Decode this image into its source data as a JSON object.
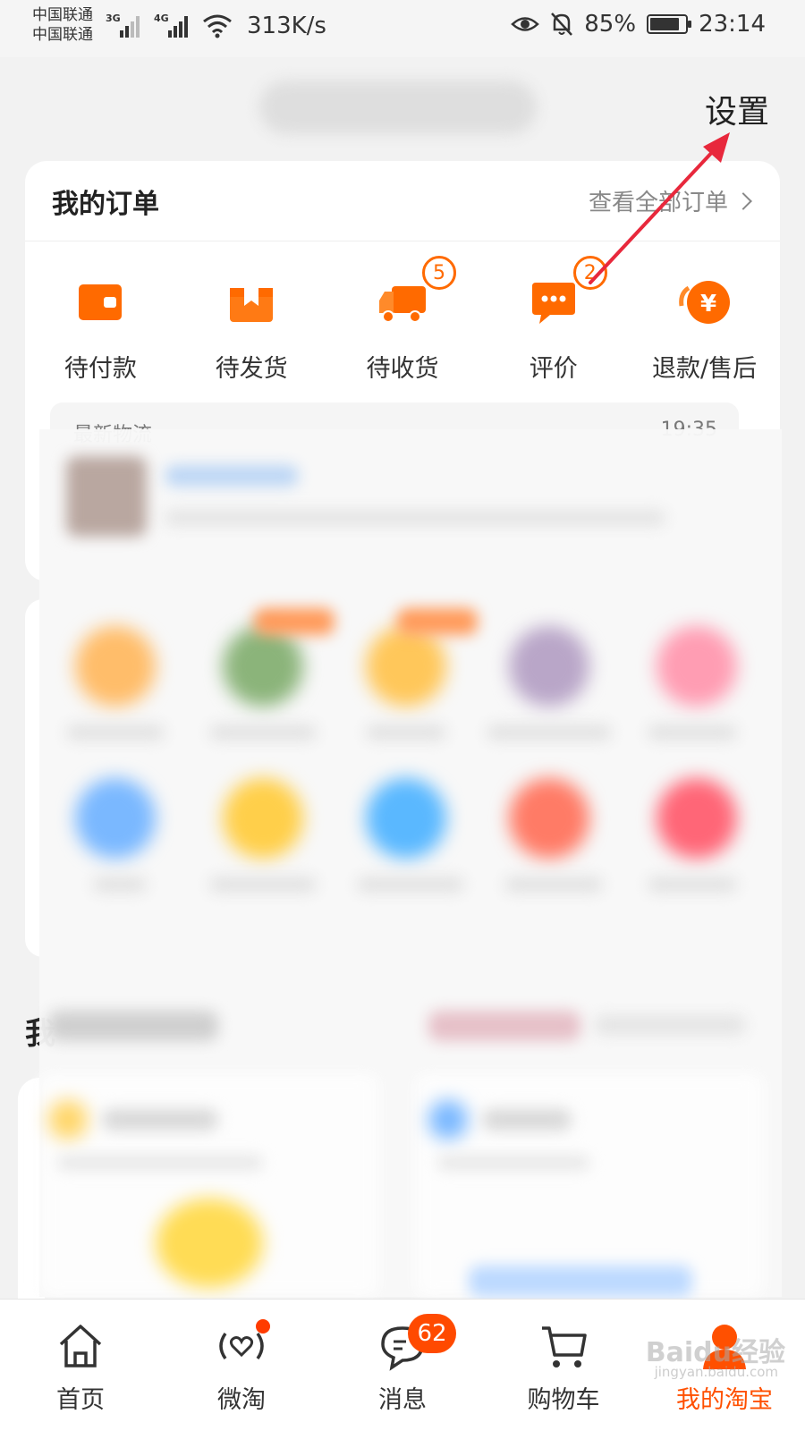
{
  "status_bar": {
    "carrier_1": "中国联通",
    "carrier_2": "中国联通",
    "net_1": "3G",
    "net_2": "4G",
    "speed": "313K/s",
    "battery": "85%",
    "battery_level": 0.85,
    "time": "23:14"
  },
  "header": {
    "settings_label": "设置"
  },
  "orders": {
    "title": "我的订单",
    "view_all": "查看全部订单",
    "items": [
      {
        "label": "待付款",
        "icon": "wallet-icon"
      },
      {
        "label": "待发货",
        "icon": "package-icon"
      },
      {
        "label": "待收货",
        "icon": "truck-icon",
        "badge": "5"
      },
      {
        "label": "评价",
        "icon": "comment-icon",
        "badge": "2"
      },
      {
        "label": "退款/售后",
        "icon": "refund-icon"
      }
    ],
    "logistics": {
      "label": "最新物流",
      "time": "19:35"
    }
  },
  "section_partial": "我",
  "tabbar": {
    "items": [
      {
        "label": "首页",
        "icon": "home-icon"
      },
      {
        "label": "微淘",
        "icon": "weitao-icon"
      },
      {
        "label": "消息",
        "icon": "message-icon",
        "badge": "62"
      },
      {
        "label": "购物车",
        "icon": "cart-icon"
      },
      {
        "label": "我的淘宝",
        "icon": "profile-icon",
        "active": true
      }
    ],
    "watermark": "Baidu经验",
    "watermark_sub": "jingyan.baidu.com"
  },
  "colors": {
    "accent": "#ff5000",
    "orange_icon": "#ff6a00",
    "annotation_arrow": "#e8283c"
  }
}
